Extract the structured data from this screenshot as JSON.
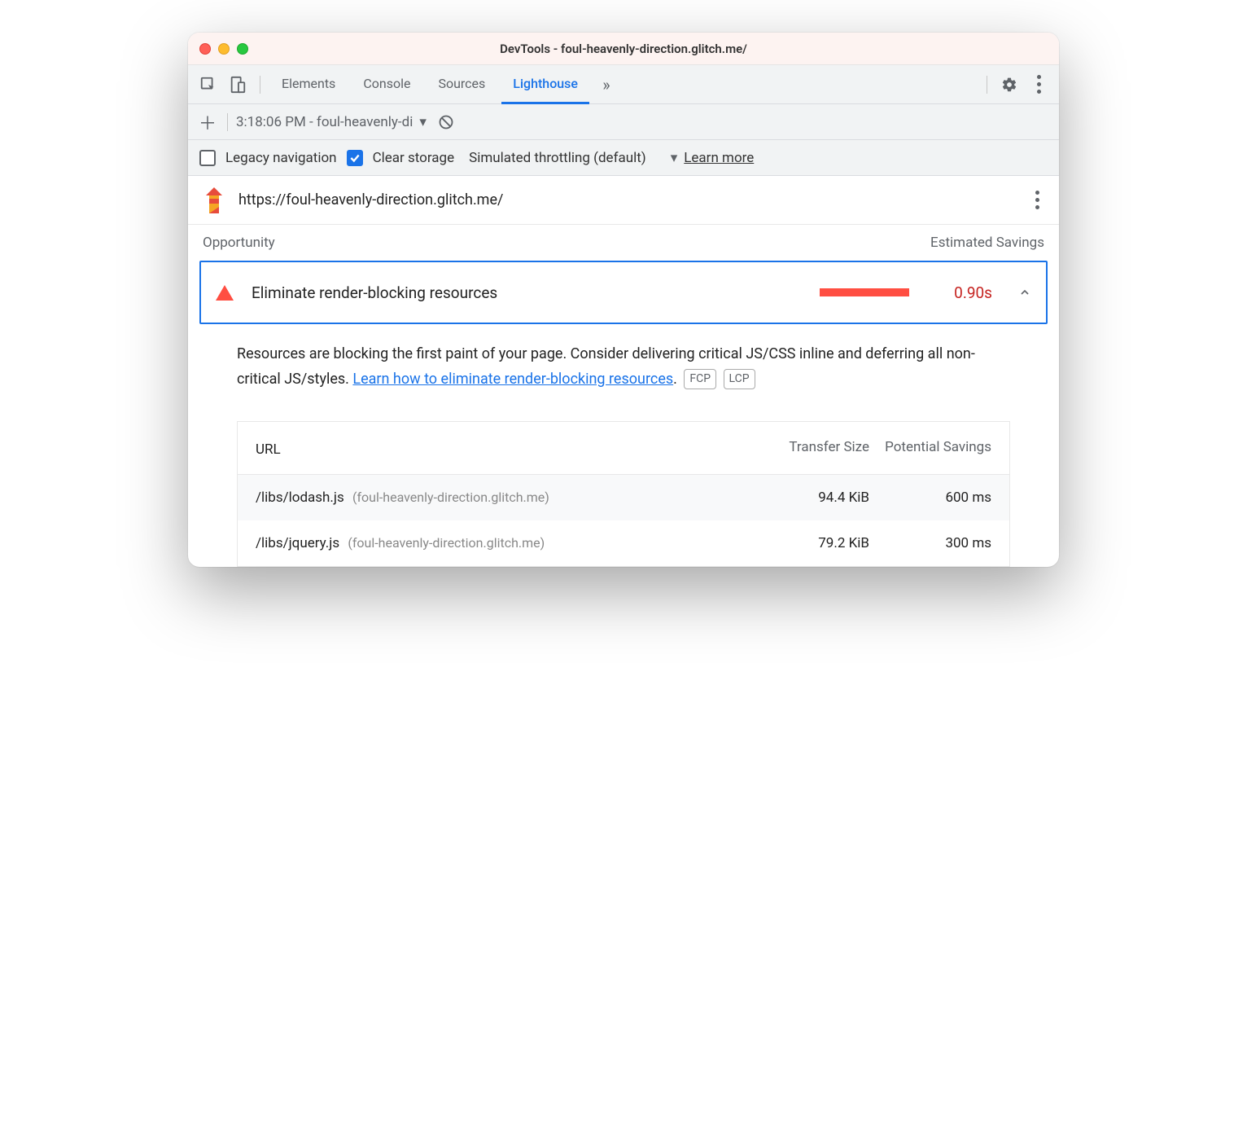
{
  "window": {
    "title": "DevTools - foul-heavenly-direction.glitch.me/"
  },
  "tabs": {
    "items": [
      "Elements",
      "Console",
      "Sources",
      "Lighthouse"
    ],
    "active": "Lighthouse"
  },
  "subbar": {
    "report_label": "3:18:06 PM - foul-heavenly-di"
  },
  "options": {
    "legacy_label": "Legacy navigation",
    "legacy_checked": false,
    "clear_label": "Clear storage",
    "clear_checked": true,
    "throttling_label": "Simulated throttling (default)",
    "learn_more": "Learn more"
  },
  "url": "https://foul-heavenly-direction.glitch.me/",
  "opportunity": {
    "header_left": "Opportunity",
    "header_right": "Estimated Savings",
    "title": "Eliminate render-blocking resources",
    "value": "0.90s",
    "description_pre": "Resources are blocking the first paint of your page. Consider delivering critical JS/CSS inline and deferring all non-critical JS/styles. ",
    "learn_link": "Learn how to eliminate render-blocking resources",
    "description_post": ".",
    "tags": [
      "FCP",
      "LCP"
    ],
    "table": {
      "headers": {
        "url": "URL",
        "size": "Transfer Size",
        "savings": "Potential Savings"
      },
      "rows": [
        {
          "path": "/libs/lodash.js",
          "host": "(foul-heavenly-direction.glitch.me)",
          "size": "94.4 KiB",
          "savings": "600 ms"
        },
        {
          "path": "/libs/jquery.js",
          "host": "(foul-heavenly-direction.glitch.me)",
          "size": "79.2 KiB",
          "savings": "300 ms"
        }
      ]
    }
  }
}
